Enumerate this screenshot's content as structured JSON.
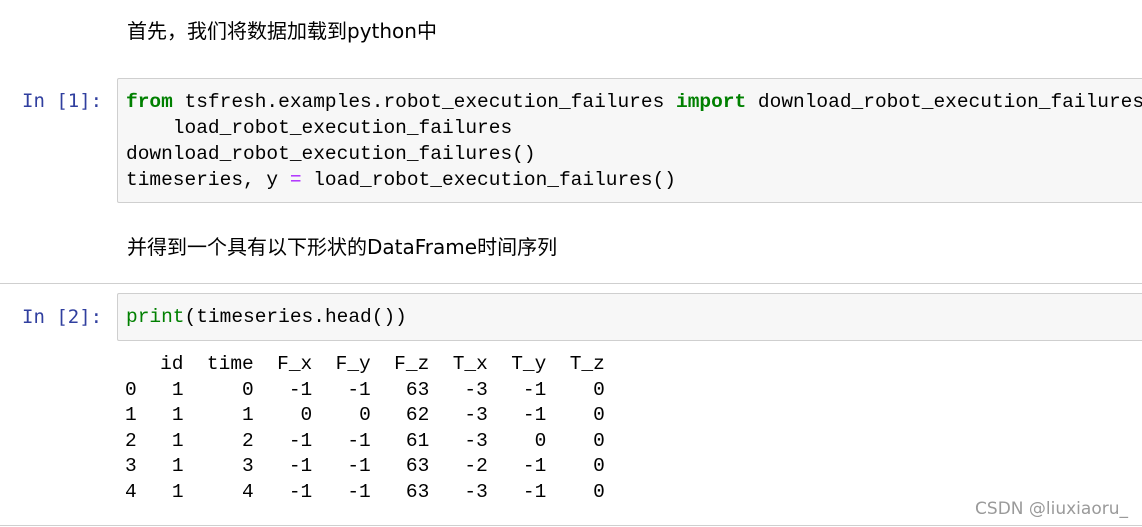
{
  "cells": [
    {
      "type": "markdown",
      "text": "首先，我们将数据加载到python中"
    },
    {
      "type": "code",
      "prompt": "In  [1]:",
      "lines": [
        [
          {
            "t": "from",
            "c": "kw"
          },
          {
            "t": " tsfresh.examples.robot_execution_failures ",
            "c": ""
          },
          {
            "t": "import",
            "c": "kw"
          },
          {
            "t": " download_robot_execution_failures, \\",
            "c": ""
          }
        ],
        [
          {
            "t": "    load_robot_execution_failures",
            "c": ""
          }
        ],
        [
          {
            "t": "download_robot_execution_failures()",
            "c": ""
          }
        ],
        [
          {
            "t": "timeseries, y ",
            "c": ""
          },
          {
            "t": "=",
            "c": "op"
          },
          {
            "t": " load_robot_execution_failures()",
            "c": ""
          }
        ]
      ]
    },
    {
      "type": "markdown",
      "text": "并得到一个具有以下形状的DataFrame时间序列"
    },
    {
      "type": "code",
      "prompt": "In  [2]:",
      "lines": [
        [
          {
            "t": "print",
            "c": "bi"
          },
          {
            "t": "(timeseries.head())",
            "c": ""
          }
        ]
      ]
    }
  ],
  "output": {
    "columns": [
      "id",
      "time",
      "F_x",
      "F_y",
      "F_z",
      "T_x",
      "T_y",
      "T_z"
    ],
    "rows": [
      {
        "index": "0",
        "values": [
          "1",
          "0",
          "-1",
          "-1",
          "63",
          "-3",
          "-1",
          "0"
        ]
      },
      {
        "index": "1",
        "values": [
          "1",
          "1",
          "0",
          "0",
          "62",
          "-3",
          "-1",
          "0"
        ]
      },
      {
        "index": "2",
        "values": [
          "1",
          "2",
          "-1",
          "-1",
          "61",
          "-3",
          "0",
          "0"
        ]
      },
      {
        "index": "3",
        "values": [
          "1",
          "3",
          "-1",
          "-1",
          "63",
          "-2",
          "-1",
          "0"
        ]
      },
      {
        "index": "4",
        "values": [
          "1",
          "4",
          "-1",
          "-1",
          "63",
          "-3",
          "-1",
          "0"
        ]
      }
    ]
  },
  "watermark": "CSDN @liuxiaoru_"
}
